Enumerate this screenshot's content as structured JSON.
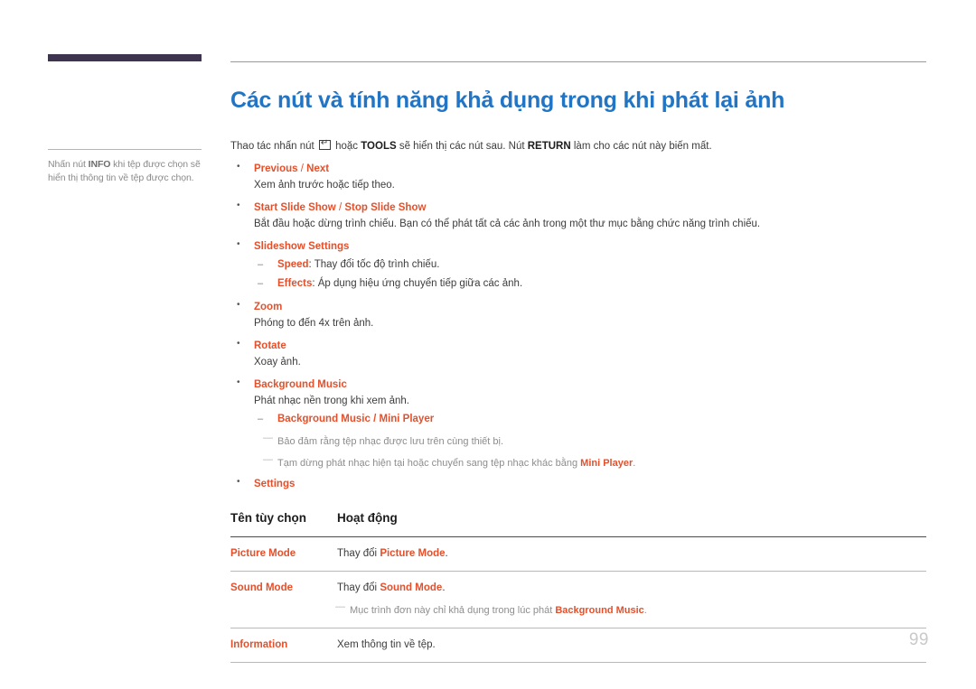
{
  "sidebar": {
    "tab_marker": "section-tab",
    "note": {
      "pre": "Nhấn nút ",
      "bold": "INFO",
      "post": " khi tệp được chọn sẽ hiển thị thông tin về tệp được chọn."
    }
  },
  "main": {
    "title": "Các nút và tính năng khả dụng trong khi phát lại ảnh",
    "intro": {
      "part1": "Thao tác nhấn nút ",
      "icon": "enter-key-icon",
      "part2": " hoặc ",
      "bold1": "TOOLS",
      "part3": " sẽ hiển thị các nút sau. Nút ",
      "bold2": "RETURN",
      "part4": " làm cho các nút này biến mất."
    },
    "bullets": [
      {
        "label": "Previous",
        "separator": " / ",
        "label2": "Next",
        "desc": "Xem ảnh trước hoặc tiếp theo."
      },
      {
        "label": "Start Slide Show",
        "separator": " / ",
        "label2": "Stop Slide Show",
        "desc": "Bắt đầu hoặc dừng trình chiếu. Bạn có thể phát tất cả các ảnh trong một thư mục bằng chức năng trình chiếu."
      },
      {
        "label": "Slideshow Settings",
        "sub": [
          {
            "key": "Speed",
            "text": ": Thay đổi tốc độ trình chiếu."
          },
          {
            "key": "Effects",
            "text": ": Áp dụng hiệu ứng chuyển tiếp giữa các ảnh."
          }
        ]
      },
      {
        "label": "Zoom",
        "desc": "Phóng to đến 4x trên ảnh."
      },
      {
        "label": "Rotate",
        "desc": "Xoay ảnh."
      },
      {
        "label": "Background Music",
        "desc": "Phát nhạc nền trong khi xem ảnh.",
        "sub_label": "Background Music",
        "sub_separator": " / ",
        "sub_label2": "Mini Player",
        "notes": [
          {
            "text": "Bảo đảm rằng tệp nhạc được lưu trên cùng thiết bị.",
            "bold": "",
            "after": ""
          },
          {
            "text": "Tạm dừng phát nhạc hiện tại hoặc chuyển sang tệp nhạc khác bằng ",
            "bold": "Mini Player",
            "after": "."
          }
        ]
      },
      {
        "label": "Settings"
      }
    ],
    "table": {
      "headers": [
        "Tên tùy chọn",
        "Hoạt động"
      ],
      "rows": [
        {
          "name": "Picture Mode",
          "action_pre": "Thay đổi ",
          "action_key": "Picture Mode",
          "action_post": ".",
          "note": null
        },
        {
          "name": "Sound Mode",
          "action_pre": "Thay đổi ",
          "action_key": "Sound Mode",
          "action_post": ".",
          "note": {
            "text": "Mục trình đơn này chỉ khả dụng trong lúc phát ",
            "bold": "Background Music",
            "after": "."
          }
        },
        {
          "name": "Information",
          "action_pre": "Xem thông tin về tệp.",
          "action_key": "",
          "action_post": "",
          "note": null
        }
      ]
    }
  },
  "page_number": "99",
  "colors": {
    "title_blue": "#2175c4",
    "accent_orange": "#e4502b",
    "sidebar_tab": "#3e3450",
    "sidebar_divider": "#c6a8c9",
    "note_gray": "#8d8d8d",
    "page_number_gray": "#c9c9c9"
  }
}
